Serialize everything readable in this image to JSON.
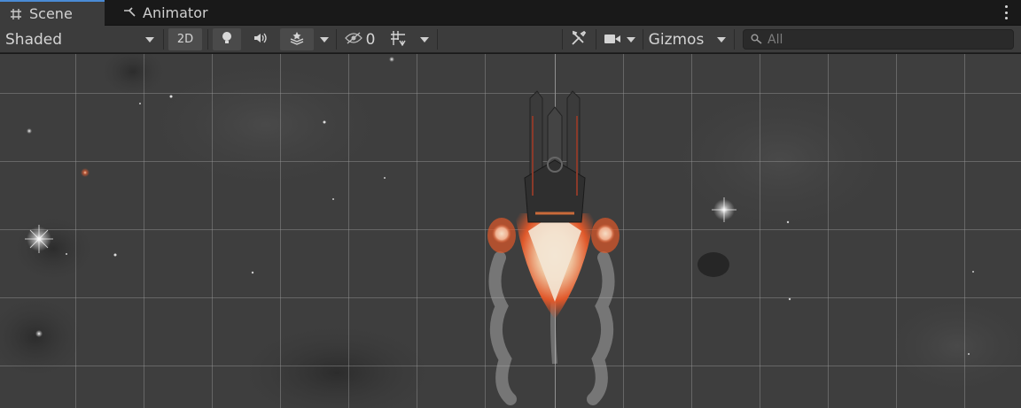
{
  "tabs": {
    "scene_label": "Scene",
    "animator_label": "Animator"
  },
  "toolbar": {
    "shading_mode": "Shaded",
    "mode_2d_label": "2D",
    "hidden_count": "0",
    "gizmos_label": "Gizmos"
  },
  "search": {
    "placeholder": "All"
  },
  "colors": {
    "accent": "#4a8bd5",
    "viewport_bg": "#3e3e3e",
    "thruster_orange": "#e0582a"
  }
}
